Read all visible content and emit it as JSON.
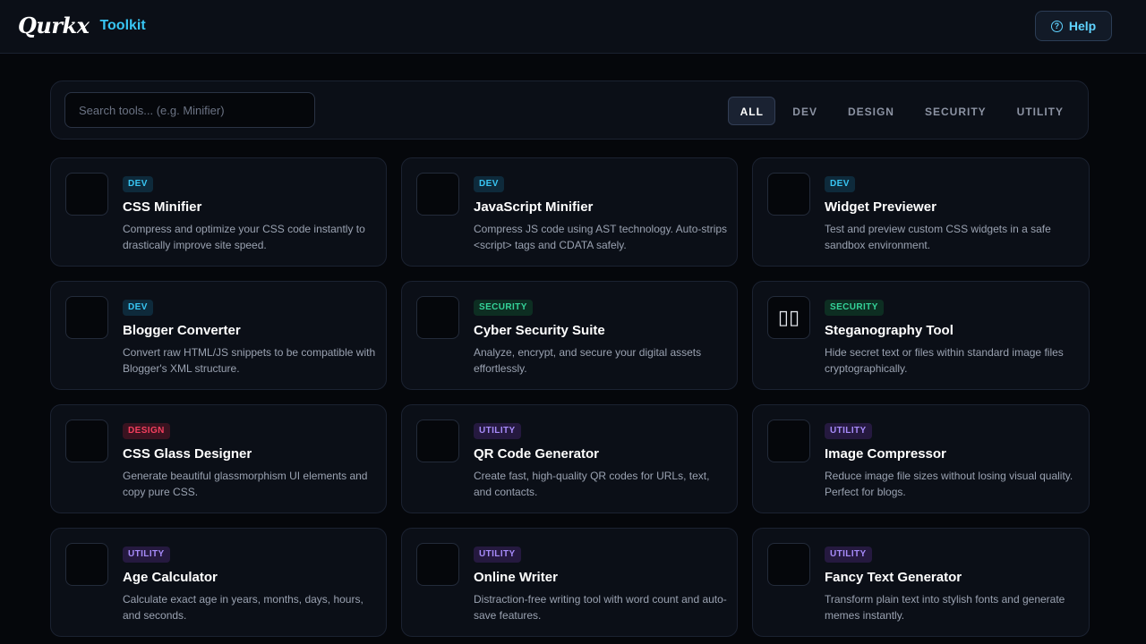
{
  "header": {
    "logo": "Qurkx",
    "subtitle": "Toolkit",
    "help_label": "Help"
  },
  "search": {
    "placeholder": "Search tools... (e.g. Minifier)"
  },
  "filters": [
    "ALL",
    "DEV",
    "DESIGN",
    "SECURITY",
    "UTILITY"
  ],
  "active_filter": "ALL",
  "tools": [
    {
      "category": "DEV",
      "title": "CSS Minifier",
      "description": "Compress and optimize your CSS code instantly to drastically improve site speed.",
      "icon": ""
    },
    {
      "category": "DEV",
      "title": "JavaScript Minifier",
      "description": "Compress JS code using AST technology. Auto-strips <script> tags and CDATA safely.",
      "icon": ""
    },
    {
      "category": "DEV",
      "title": "Widget Previewer",
      "description": "Test and preview custom CSS widgets in a safe sandbox environment.",
      "icon": ""
    },
    {
      "category": "DEV",
      "title": "Blogger Converter",
      "description": "Convert raw HTML/JS snippets to be compatible with Blogger's XML structure.",
      "icon": ""
    },
    {
      "category": "SECURITY",
      "title": "Cyber Security Suite",
      "description": "Analyze, encrypt, and secure your digital assets effortlessly.",
      "icon": ""
    },
    {
      "category": "SECURITY",
      "title": "Steganography Tool",
      "description": "Hide secret text or files within standard image files cryptographically.",
      "icon": "▯▯"
    },
    {
      "category": "DESIGN",
      "title": "CSS Glass Designer",
      "description": "Generate beautiful glassmorphism UI elements and copy pure CSS.",
      "icon": ""
    },
    {
      "category": "UTILITY",
      "title": "QR Code Generator",
      "description": "Create fast, high-quality QR codes for URLs, text, and contacts.",
      "icon": ""
    },
    {
      "category": "UTILITY",
      "title": "Image Compressor",
      "description": "Reduce image file sizes without losing visual quality. Perfect for blogs.",
      "icon": ""
    },
    {
      "category": "UTILITY",
      "title": "Age Calculator",
      "description": "Calculate exact age in years, months, days, hours, and seconds.",
      "icon": ""
    },
    {
      "category": "UTILITY",
      "title": "Online Writer",
      "description": "Distraction-free writing tool with word count and auto-save features.",
      "icon": ""
    },
    {
      "category": "UTILITY",
      "title": "Fancy Text Generator",
      "description": "Transform plain text into stylish fonts and generate memes instantly.",
      "icon": ""
    }
  ],
  "colors": {
    "accent": "#38c6f4",
    "dev": "#38c6f4",
    "security": "#34d399",
    "design": "#f43f5e",
    "utility": "#a78bfa",
    "background": "#05070b",
    "card": "#0b0f17"
  }
}
